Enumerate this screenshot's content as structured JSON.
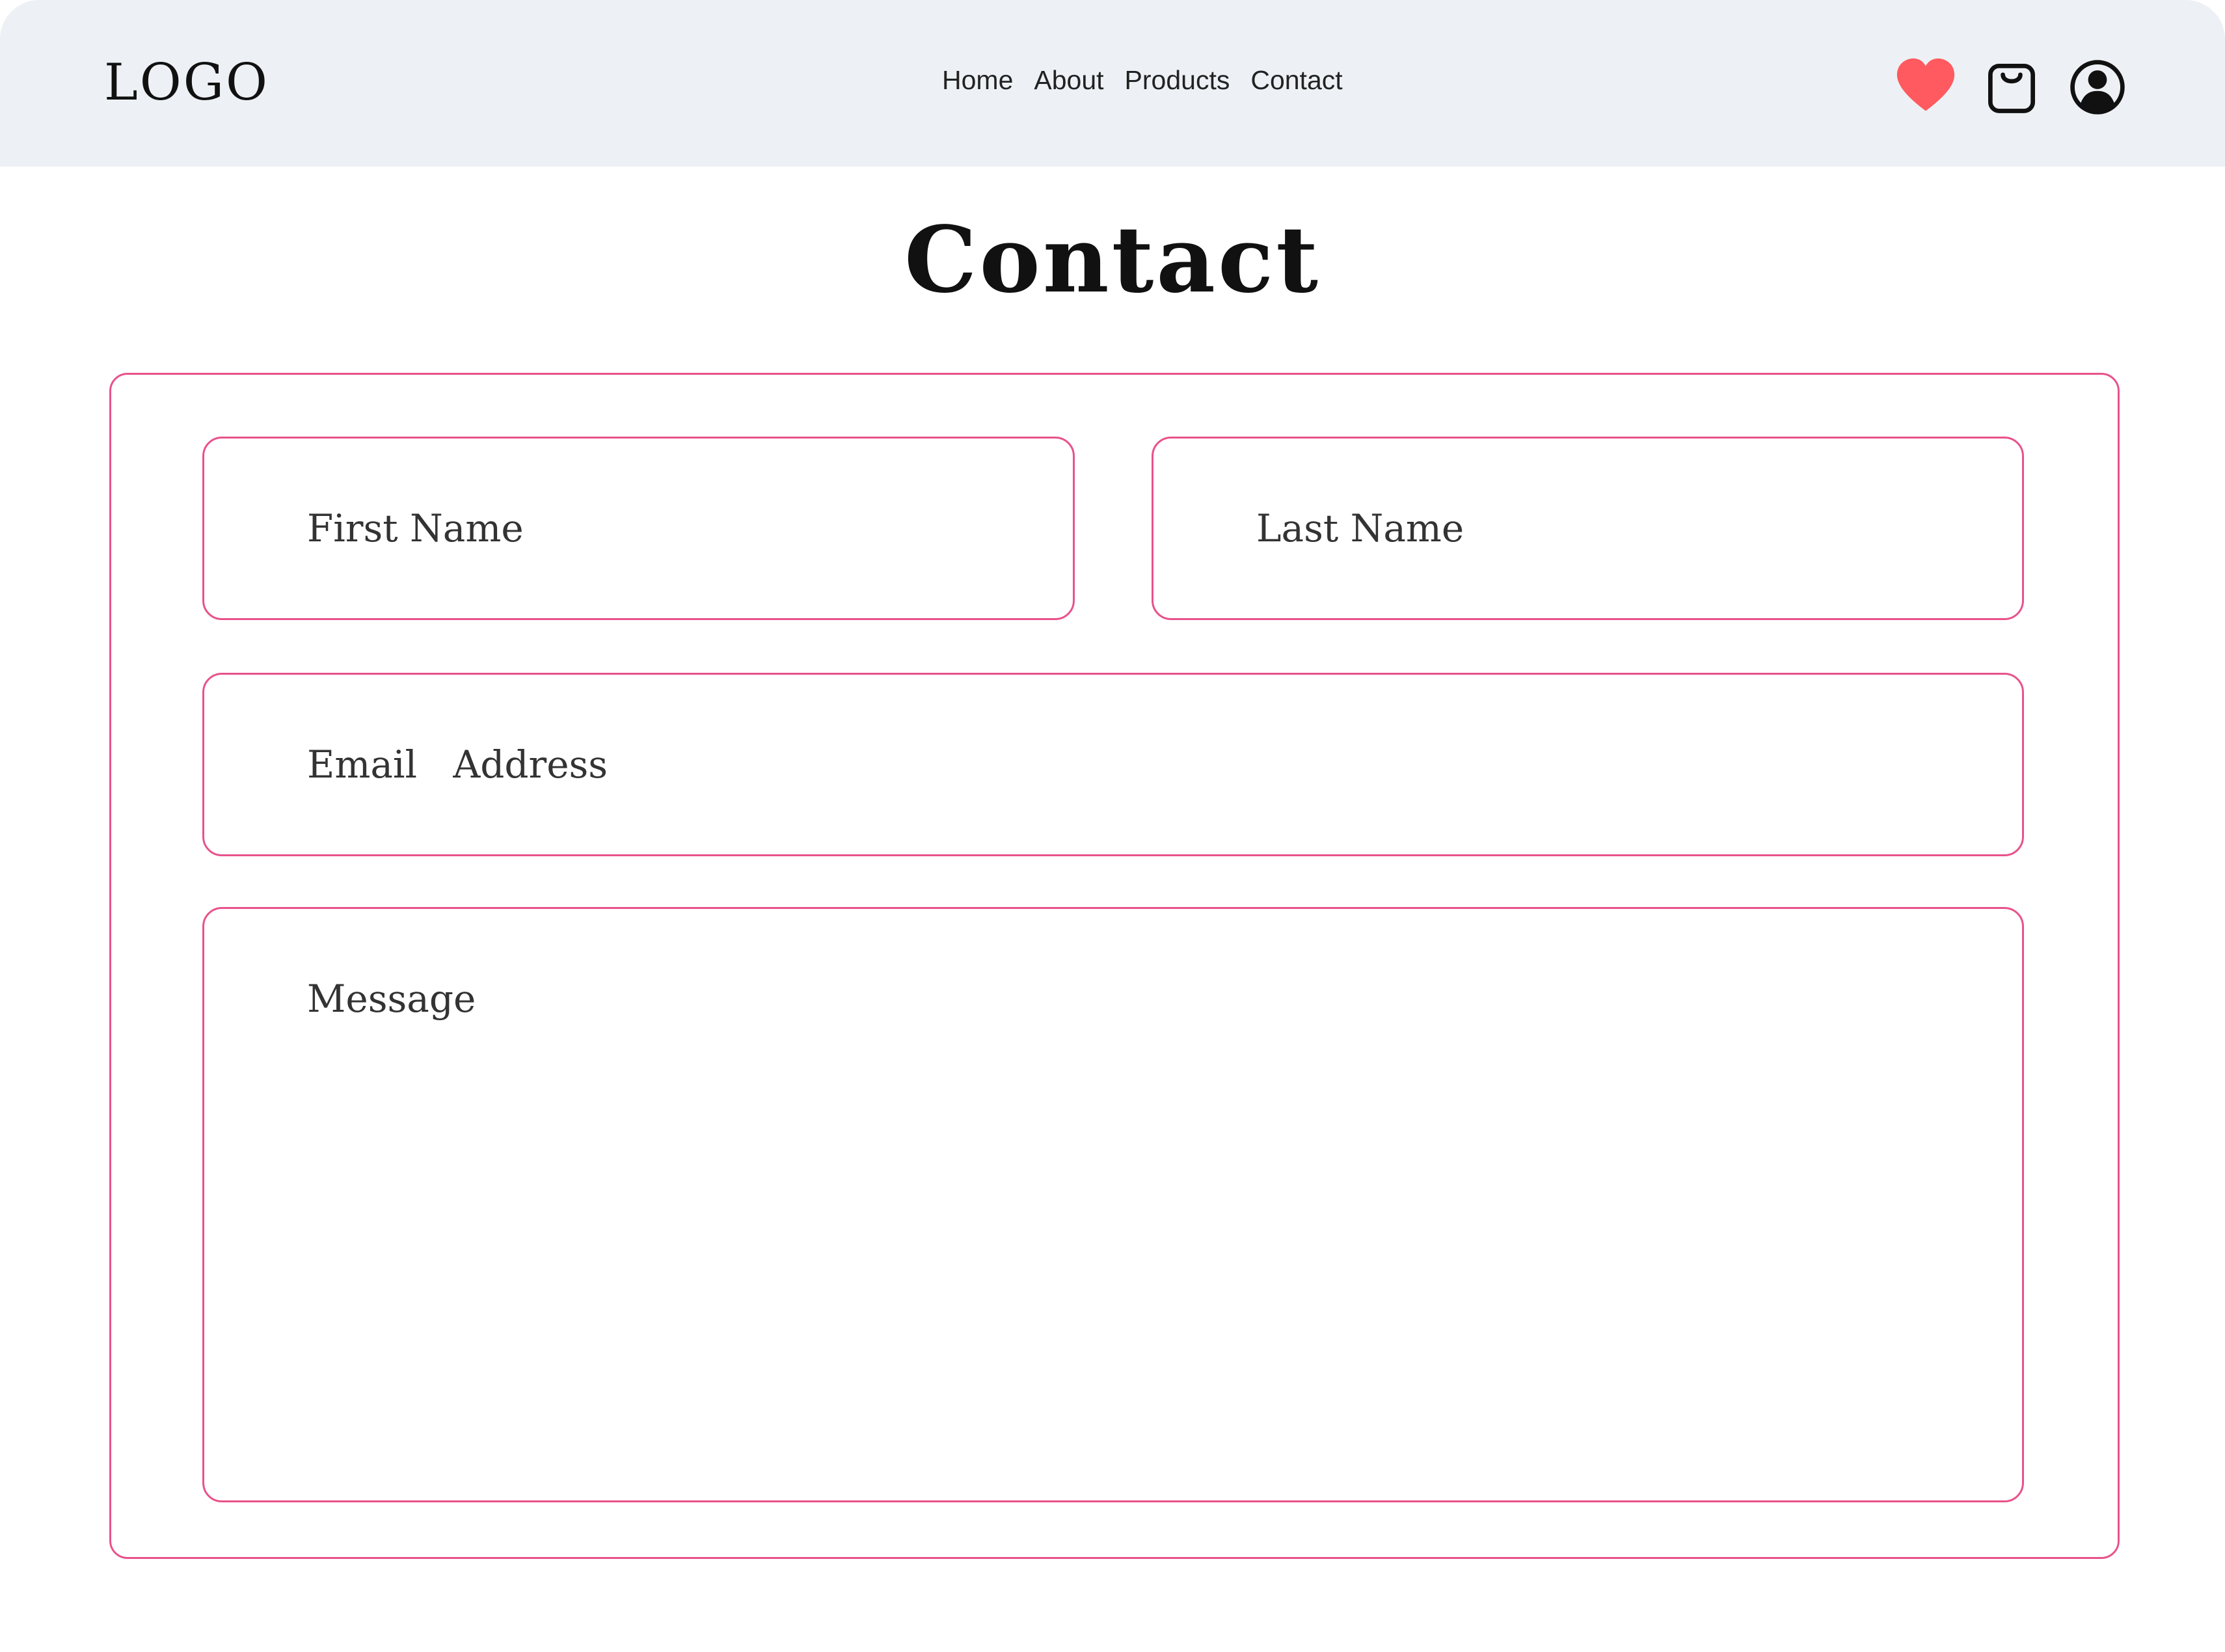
{
  "header": {
    "logo": "LOGO",
    "nav": [
      "Home",
      "About",
      "Products",
      "Contact"
    ],
    "icons": [
      "heart-icon",
      "shopping-bag-icon",
      "user-account-icon"
    ],
    "heart_color": "#ff5a5f",
    "background": "#edf1f5"
  },
  "main": {
    "title": "Contact",
    "accent_color": "#e8528b",
    "form": {
      "first_name_placeholder": "First Name",
      "last_name_placeholder": "Last Name",
      "email_placeholder": "Email   Address",
      "message_placeholder": "Message"
    }
  }
}
